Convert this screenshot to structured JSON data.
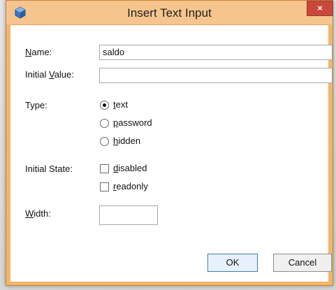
{
  "window": {
    "title": "Insert Text Input",
    "close_label": "×",
    "app_icon": "cube-icon"
  },
  "form": {
    "name_label": "Name:",
    "name_value": "saldo",
    "initial_value_label": "Initial Value:",
    "initial_value_value": "",
    "type_label": "Type:",
    "type_options": [
      {
        "label": "text",
        "selected": true
      },
      {
        "label": "password",
        "selected": false
      },
      {
        "label": "hidden",
        "selected": false
      }
    ],
    "initial_state_label": "Initial State:",
    "state_options": [
      {
        "label": "disabled",
        "checked": false
      },
      {
        "label": "readonly",
        "checked": false
      }
    ],
    "width_label": "Width:",
    "width_value": ""
  },
  "buttons": {
    "ok": "OK",
    "cancel": "Cancel"
  },
  "colors": {
    "title_bg": "#f6c48d",
    "close_bg": "#c9473b",
    "ok_border": "#3c7fb1"
  }
}
